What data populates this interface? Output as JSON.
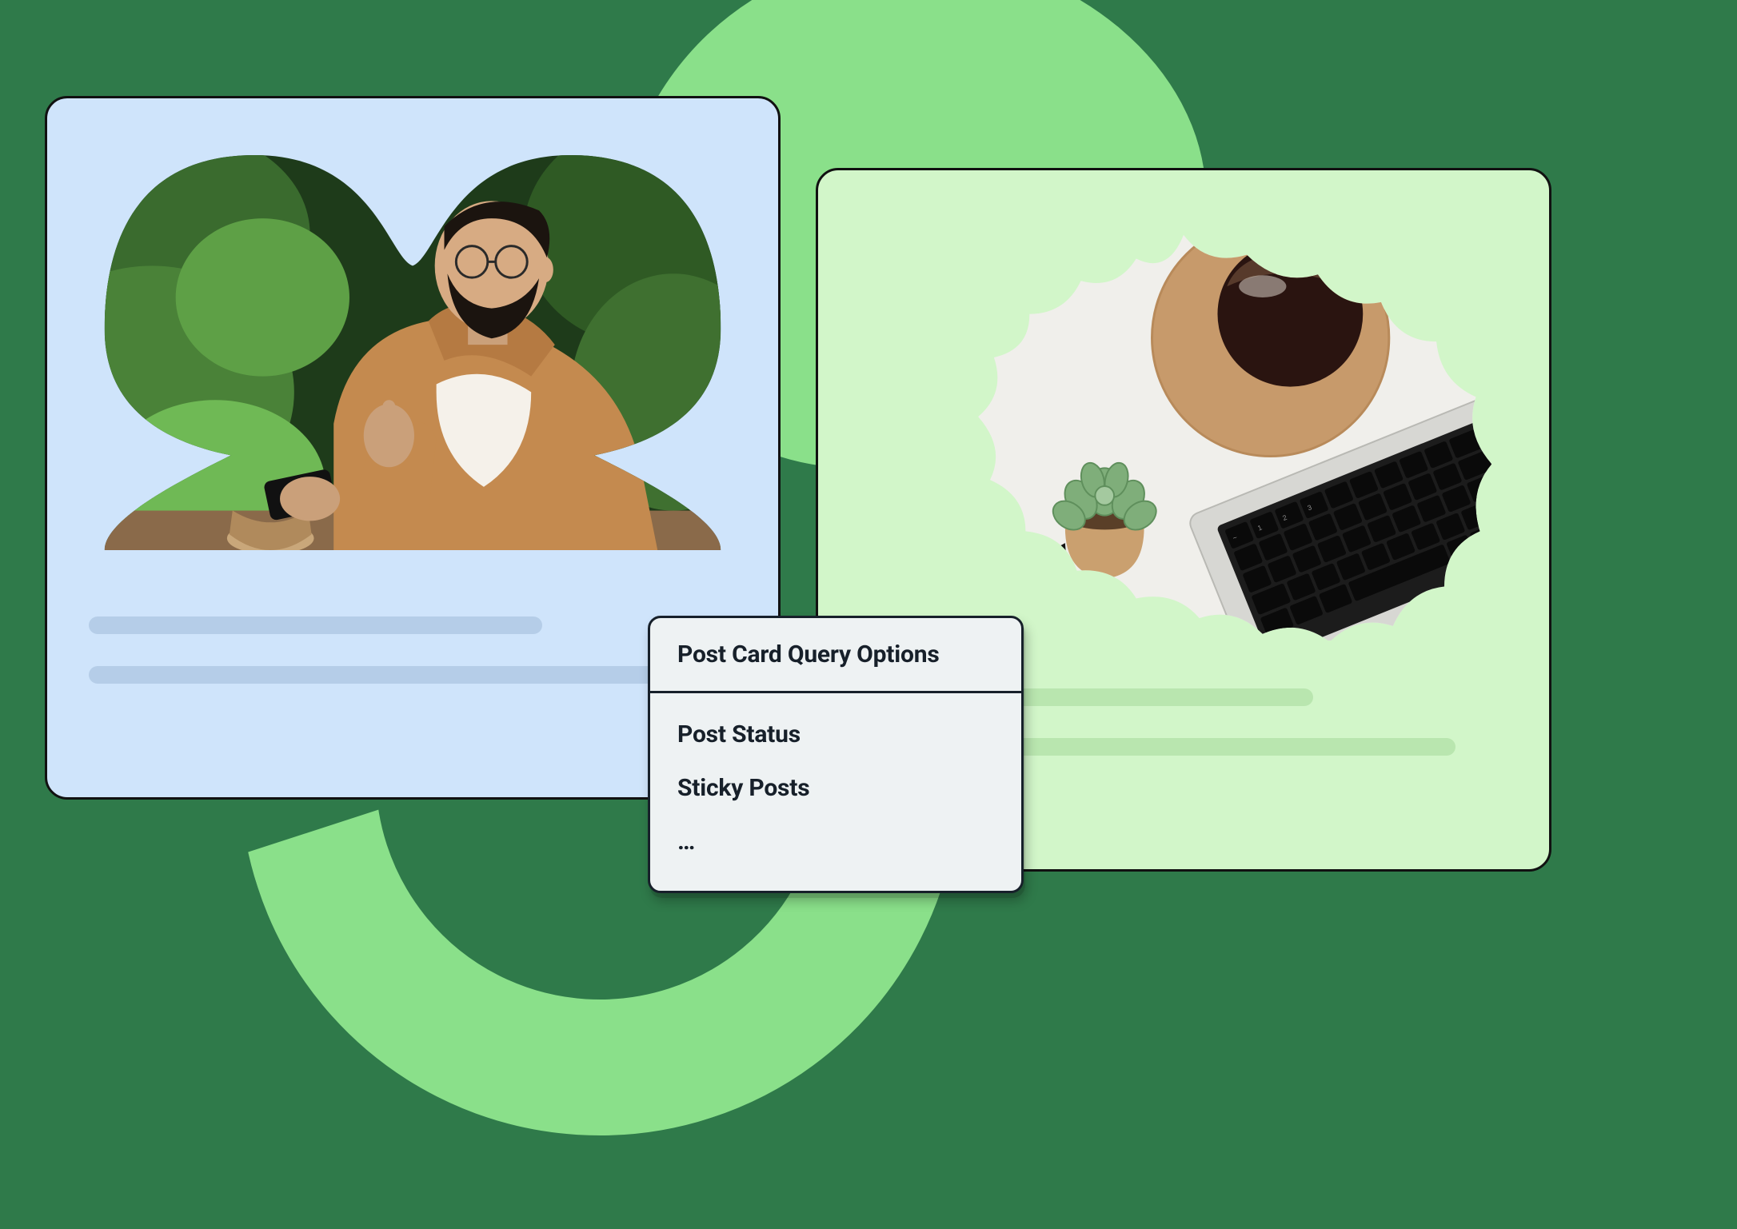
{
  "popover": {
    "title": "Post Card Query Options",
    "items": [
      {
        "label": "Post Status"
      },
      {
        "label": "Sticky Posts"
      },
      {
        "label": "…"
      }
    ]
  },
  "cards": {
    "left": {
      "image_alt": "person-with-phone",
      "bg_color": "#cfe4fb",
      "line_color": "#b5cde8"
    },
    "right": {
      "image_alt": "desk-laptop-plant",
      "bg_color": "#d2f6c9",
      "line_color": "#b9e6af"
    }
  },
  "icons": {
    "left_mask": "double-lobe-mask",
    "right_mask": "scalloped-mask"
  }
}
